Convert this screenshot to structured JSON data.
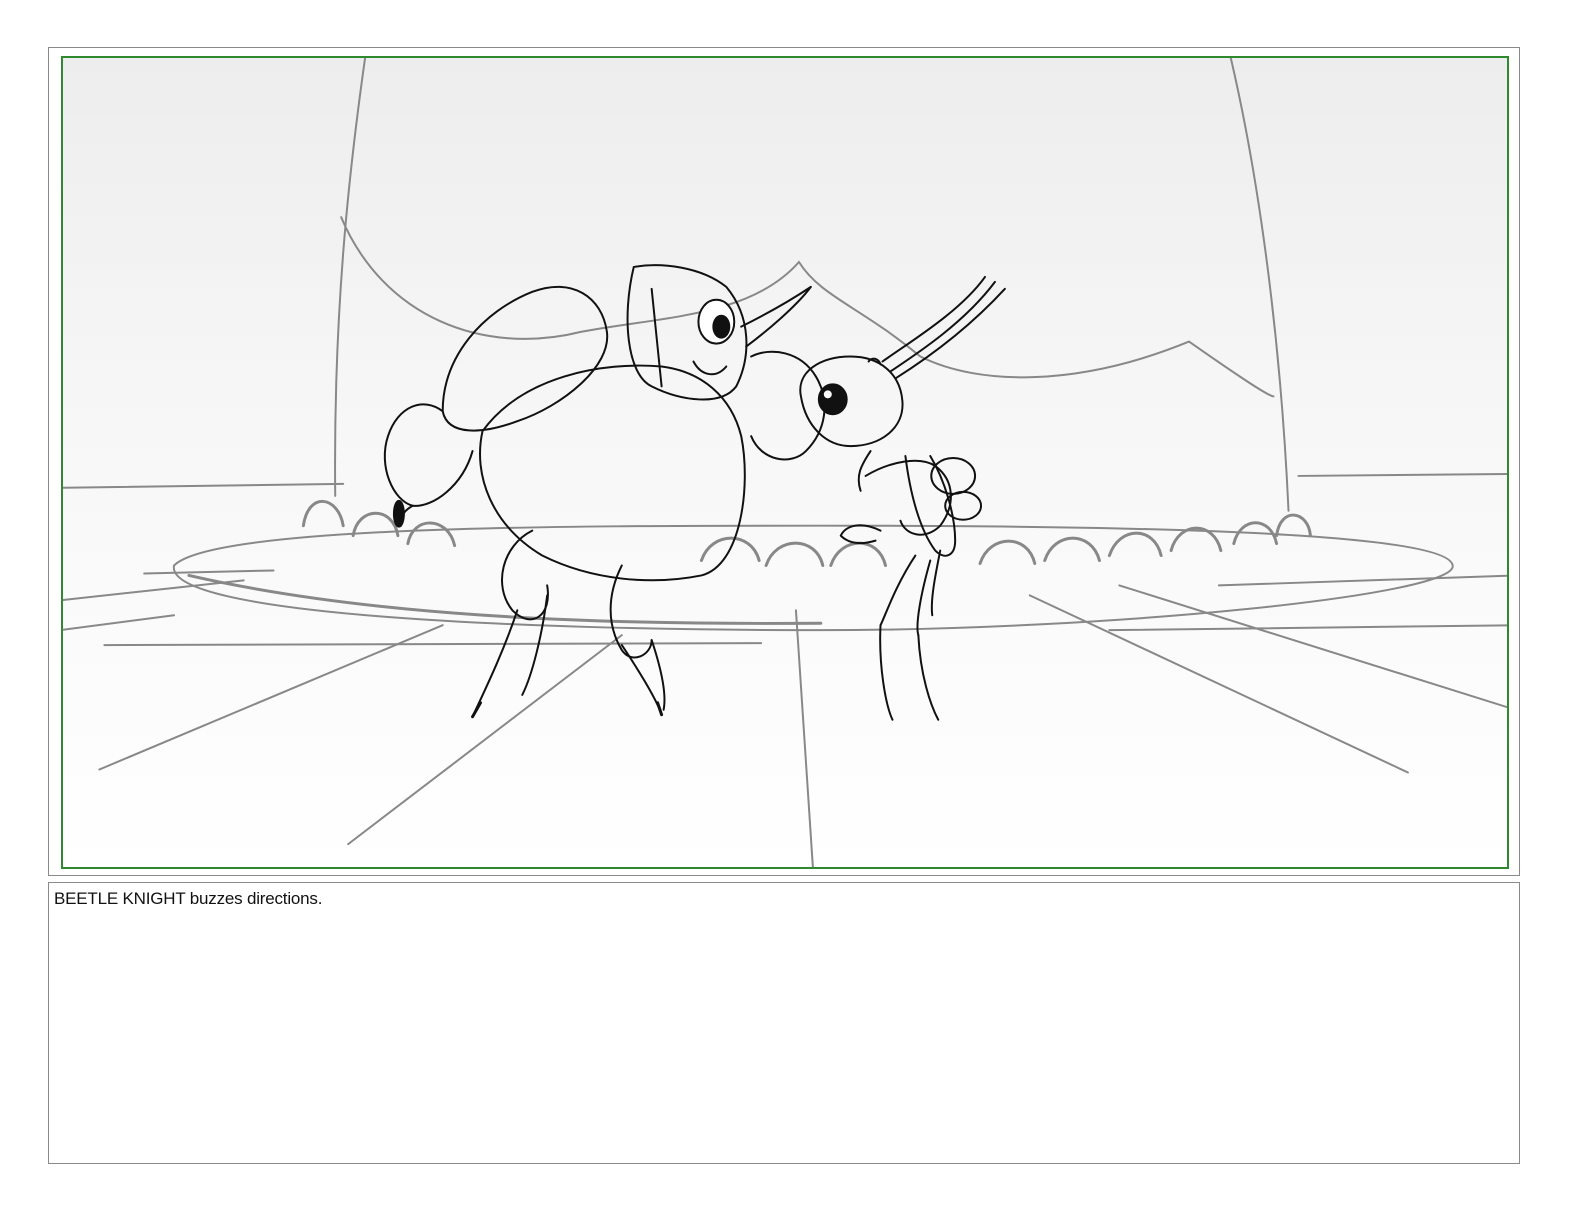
{
  "panel": {
    "description_text": "BEETLE KNIGHT buzzes directions."
  },
  "colors": {
    "panel_border": "#2f8a2f",
    "frame_border": "#8a8a8a",
    "sketch_stroke": "#111111",
    "background_sketch": "#888888"
  }
}
